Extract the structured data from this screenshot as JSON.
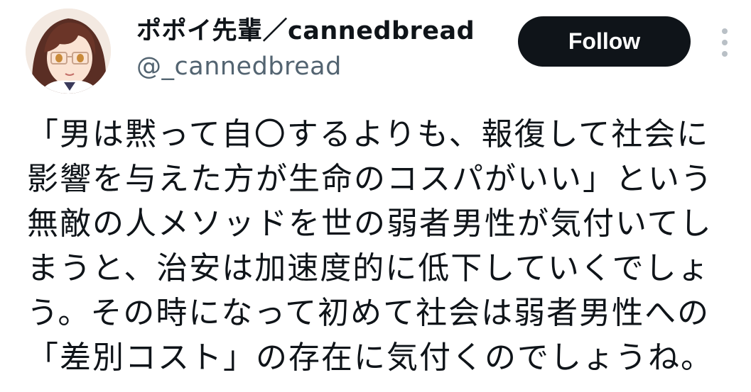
{
  "author": {
    "display_name": "ポポイ先輩／cannedbread",
    "handle": "@_cannedbread",
    "avatar_icon": "anime-girl-avatar"
  },
  "actions": {
    "follow_label": "Follow",
    "more_icon": "vertical-dots-icon"
  },
  "tweet": {
    "lines": [
      "「男は黙って自〇するよりも、報復して社会に",
      "影響を与えた方が生命のコスパがいい」という",
      "無敵の人メソッドを世の弱者男性が気付いてし",
      "まうと、治安は加速度的に低下していくでしょ",
      "う。その時になって初めて社会は弱者男性への",
      "「差別コスト」の存在に気付くのでしょうね。"
    ]
  },
  "colors": {
    "text": "#0f1419",
    "secondary": "#536471",
    "button_bg": "#0f1419",
    "button_text": "#ffffff"
  }
}
